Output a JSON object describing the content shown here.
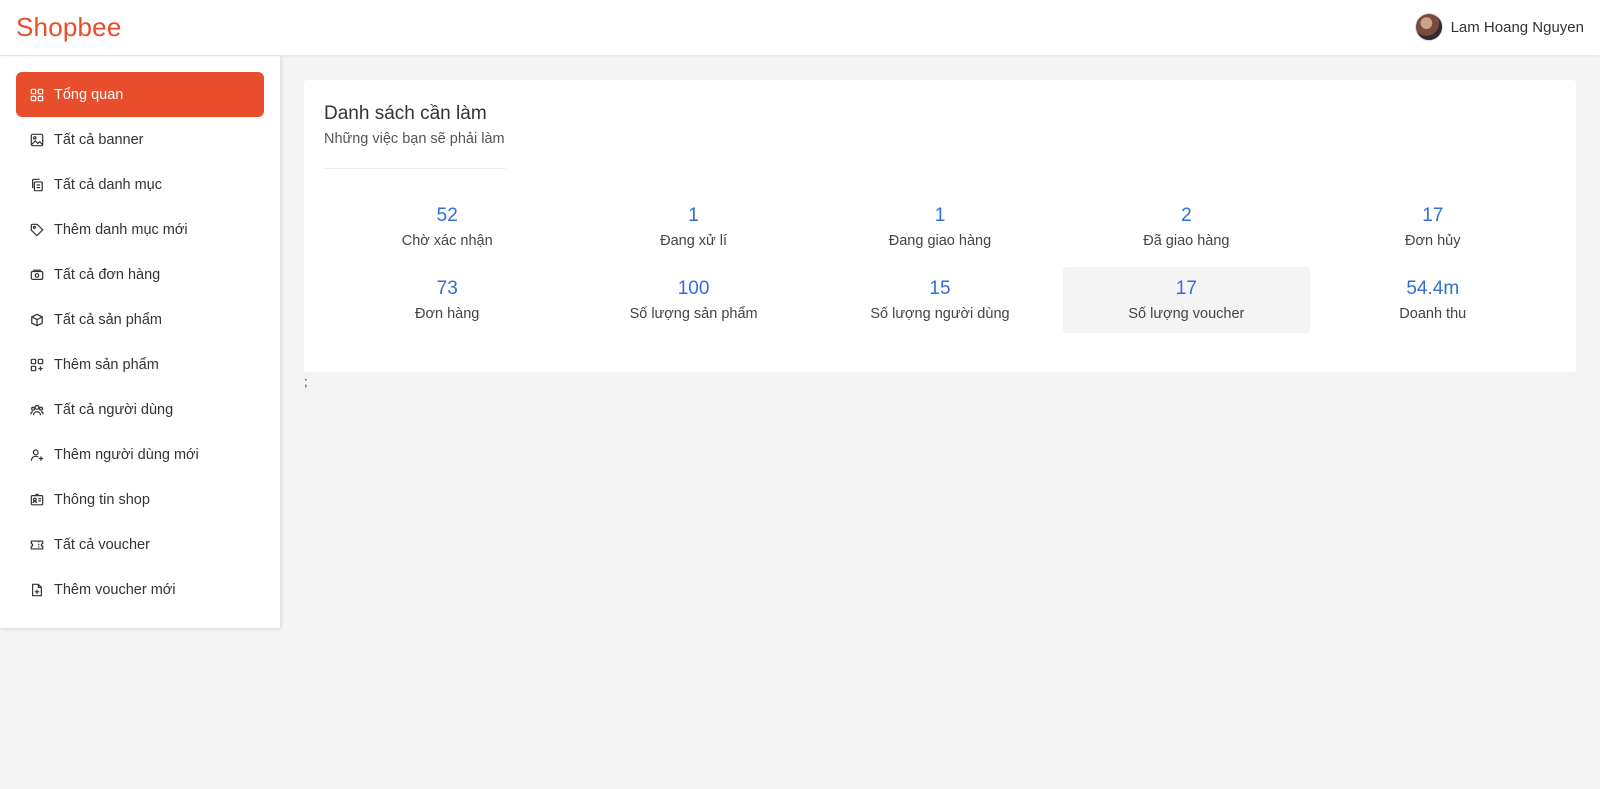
{
  "header": {
    "brand": "Shopbee",
    "user_name": "Lam Hoang Nguyen"
  },
  "sidebar": {
    "items": [
      {
        "label": "Tổng quan",
        "icon": "grid-icon",
        "active": true
      },
      {
        "label": "Tất cả banner",
        "icon": "image-icon"
      },
      {
        "label": "Tất cả danh mục",
        "icon": "copy-icon"
      },
      {
        "label": "Thêm danh mục mới",
        "icon": "tag-icon"
      },
      {
        "label": "Tất cả đơn hàng",
        "icon": "cash-icon"
      },
      {
        "label": "Tất cả sản phẩm",
        "icon": "box-icon"
      },
      {
        "label": "Thêm sản phẩm",
        "icon": "grid-plus-icon"
      },
      {
        "label": "Tất cả người dùng",
        "icon": "users-icon"
      },
      {
        "label": "Thêm người dùng mới",
        "icon": "user-plus-icon"
      },
      {
        "label": "Thông tin shop",
        "icon": "id-card-icon"
      },
      {
        "label": "Tất cả voucher",
        "icon": "ticket-icon"
      },
      {
        "label": "Thêm voucher mới",
        "icon": "file-plus-icon"
      }
    ]
  },
  "todo": {
    "title": "Danh sách cần làm",
    "subtitle": "Những việc bạn sẽ phải làm",
    "stats": [
      {
        "value": "52",
        "label": "Chờ xác nhận"
      },
      {
        "value": "1",
        "label": "Đang xử lí"
      },
      {
        "value": "1",
        "label": "Đang giao hàng"
      },
      {
        "value": "2",
        "label": "Đã giao hàng"
      },
      {
        "value": "17",
        "label": "Đơn hủy"
      },
      {
        "value": "73",
        "label": "Đơn hàng"
      },
      {
        "value": "100",
        "label": "Số lượng sản phẩm"
      },
      {
        "value": "15",
        "label": "Số lượng người dùng"
      },
      {
        "value": "17",
        "label": "Số lượng voucher"
      },
      {
        "value": "54.4m",
        "label": "Doanh thu"
      }
    ]
  },
  "stray_text": ";",
  "colors": {
    "brand": "#e84e2c",
    "stat_number": "#2f6fd6",
    "background": "#f4f4f4"
  }
}
